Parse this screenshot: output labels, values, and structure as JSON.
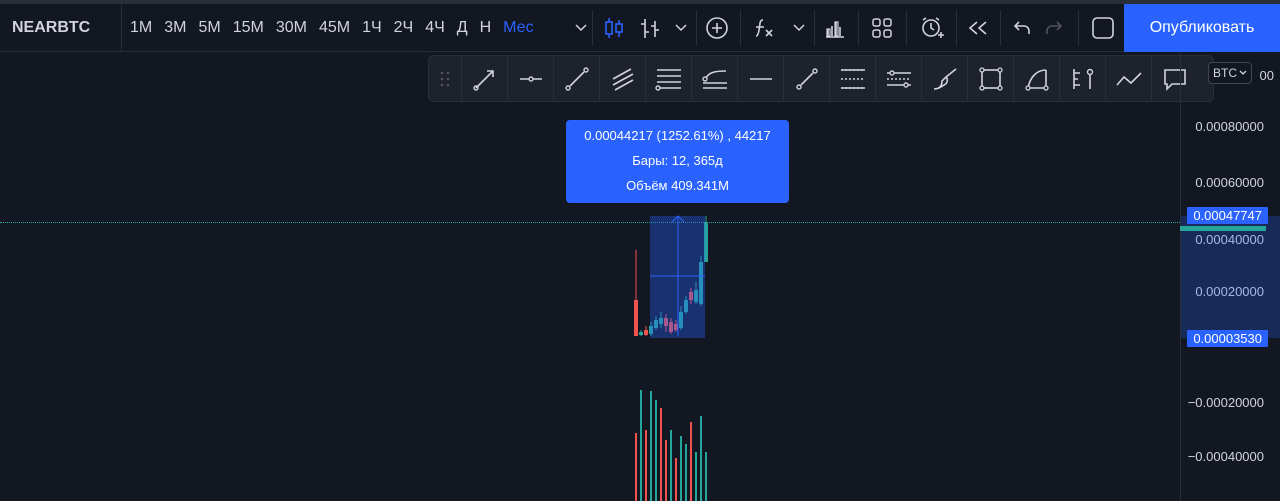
{
  "toolbar": {
    "symbol": "NEARBTC",
    "intervals": [
      "1М",
      "3М",
      "5М",
      "15М",
      "30М",
      "45М",
      "1Ч",
      "2Ч",
      "4Ч",
      "Д",
      "Н",
      "Мес"
    ],
    "active_interval": "Мес",
    "publish_label": "Опубликовать"
  },
  "chart": {
    "symbol_short": "BTC",
    "price_labels": [
      "0.00080000",
      "0.00060000",
      "0.00040000",
      "0.00020000",
      "−0.00020000",
      "−0.00040000"
    ],
    "last_price": "0.00047747",
    "range_low": "0.00003530",
    "top_partial": "00"
  },
  "tooltip": {
    "line1": "0.00044217 (1252.61%) , 44217",
    "line2": "Бары: 12, 365д",
    "line3": "Объём 409.341M"
  },
  "colors": {
    "background": "#131722",
    "accent": "#2962ff",
    "up": "#26a69a",
    "down": "#ef5350"
  }
}
